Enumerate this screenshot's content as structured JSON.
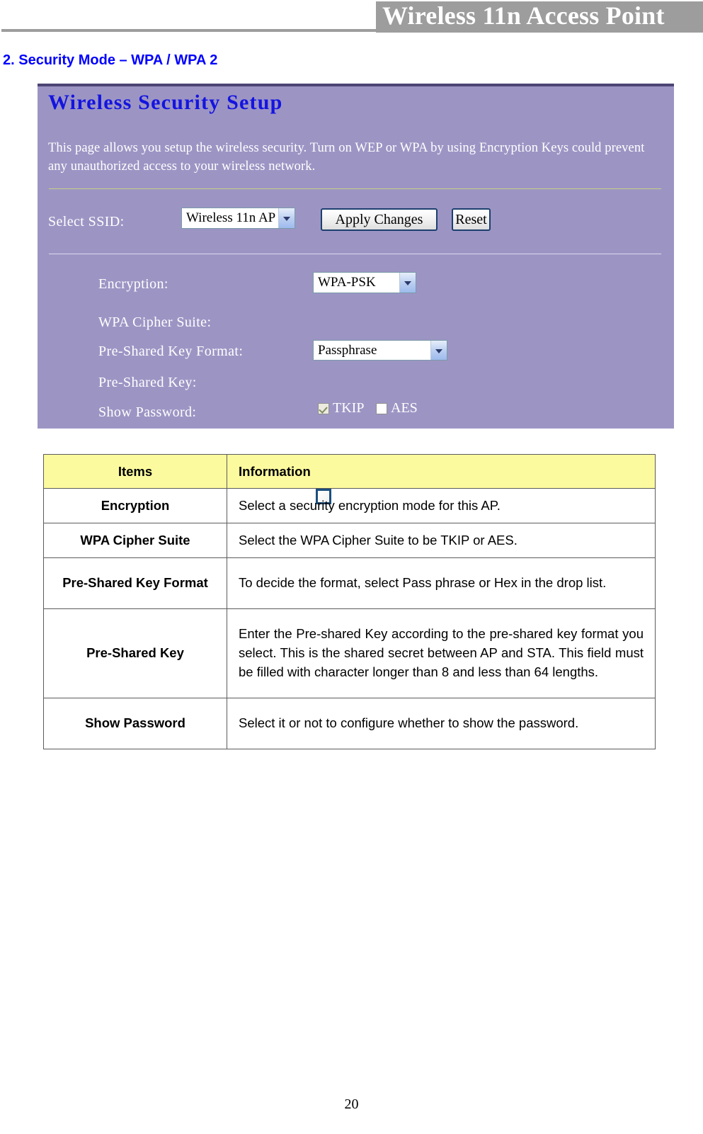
{
  "header": {
    "title": "Wireless 11n Access Point"
  },
  "section": {
    "heading": "2. Security Mode – WPA / WPA 2"
  },
  "router_panel": {
    "title": "Wireless Security Setup",
    "description_line1": "This page allows you setup the wireless security. Turn on WEP or WPA by using Encryption Keys could prevent",
    "description_line2": "any unauthorized access to your wireless network.",
    "ssid_label": "Select SSID:",
    "ssid_value": "Wireless 11n AP",
    "apply_button": "Apply Changes",
    "reset_button": "Reset",
    "encryption_label": "Encryption:",
    "encryption_value": "WPA-PSK",
    "cipher_label": "WPA Cipher Suite:",
    "cipher_tkip_label": "TKIP",
    "cipher_aes_label": "AES",
    "psk_format_label": "Pre-Shared Key Format:",
    "psk_format_value": "Passphrase",
    "psk_label": "Pre-Shared Key:",
    "psk_value": "",
    "show_password_label": "Show Password:",
    "colors": {
      "panel_background": "#9c95c4",
      "panel_top_border": "#4c4573",
      "title_blue": "#1414e0",
      "divider_olive": "#cbcf86",
      "divider_light": "#dcd9ea"
    }
  },
  "info_table": {
    "headers": [
      "Items",
      "Information"
    ],
    "rows": [
      {
        "item": "Encryption",
        "info": "Select a security encryption mode for this AP."
      },
      {
        "item": "WPA Cipher Suite",
        "info": "Select the WPA Cipher Suite to be TKIP or AES."
      },
      {
        "item": "Pre-Shared Key Format",
        "info": "To decide the format, select Pass phrase or Hex in the drop list."
      },
      {
        "item": "Pre-Shared Key",
        "info": "Enter the Pre-shared Key according to the pre-shared key format you select. This is the shared secret between AP and STA. This field must be filled with character longer than 8 and less than 64 lengths."
      },
      {
        "item": "Show Password",
        "info": "Select it or not to configure whether to show the password."
      }
    ],
    "header_color": "#fcfa9e"
  },
  "footer": {
    "page_number": "20"
  }
}
